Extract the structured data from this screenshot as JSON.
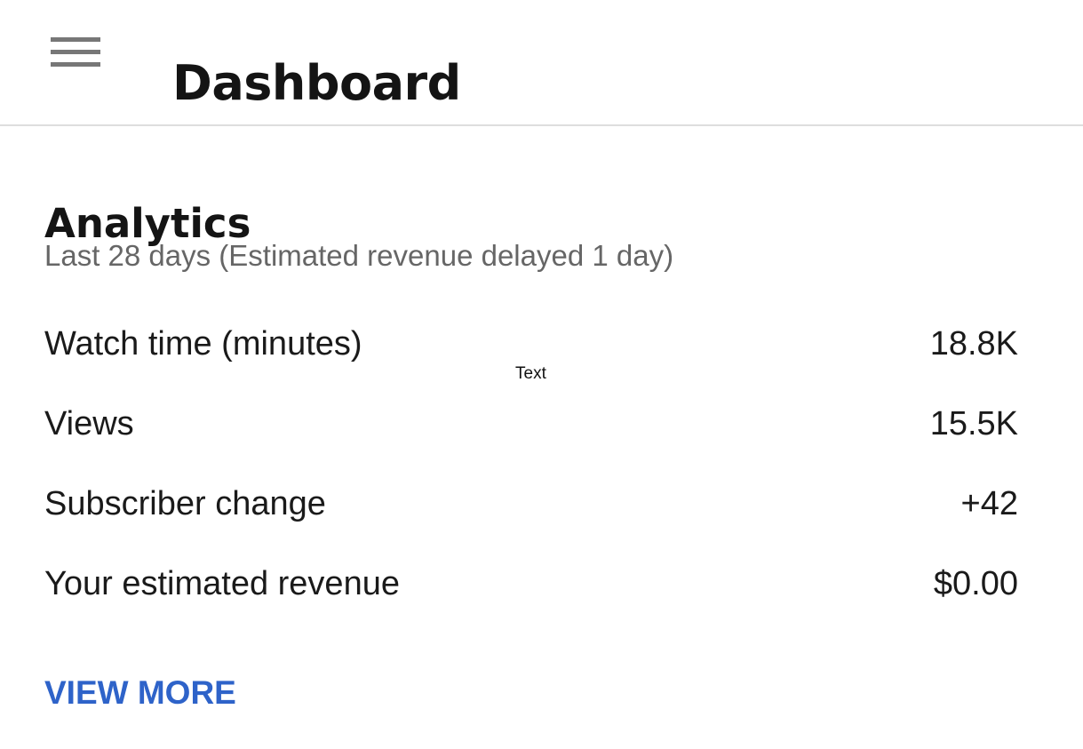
{
  "header": {
    "menu_icon": "hamburger-menu-icon",
    "title": "Dashboard"
  },
  "analytics": {
    "title": "Analytics",
    "subtitle": "Last 28 days (Estimated revenue delayed 1 day)",
    "metrics": [
      {
        "label": "Watch time (minutes)",
        "value": "18.8K"
      },
      {
        "label": "Views",
        "value": "15.5K"
      },
      {
        "label": "Subscriber change",
        "value": "+42"
      },
      {
        "label": "Your estimated revenue",
        "value": "$0.00"
      }
    ],
    "overlay_text": "Text",
    "view_more_label": "VIEW MORE"
  },
  "colors": {
    "link": "#2e63c9",
    "subtitle": "#666666",
    "divider": "#dedede",
    "text": "#1a1a1a"
  }
}
